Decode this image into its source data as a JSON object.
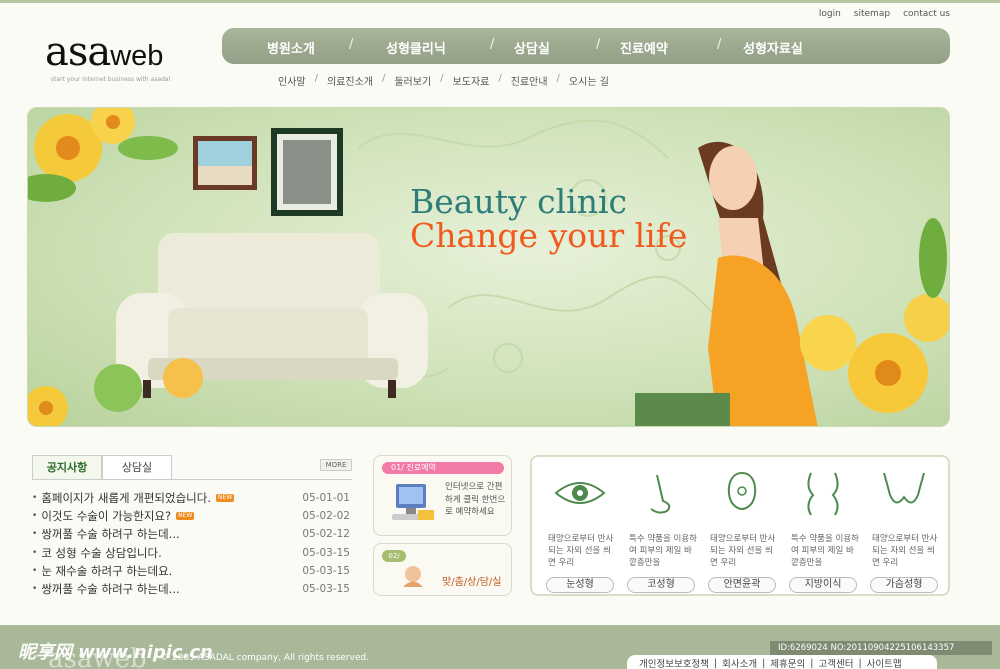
{
  "util_links": [
    "login",
    "sitemap",
    "contact us"
  ],
  "logo": {
    "main": "asa",
    "suffix": "web",
    "tagline": "start your internet business with asadal"
  },
  "gnb": {
    "items": [
      "병원소개",
      "성형클리닉",
      "상담실",
      "진료예약",
      "성형자료실"
    ],
    "separator": "/"
  },
  "subnav": {
    "items": [
      "인사말",
      "의료진소개",
      "둘러보기",
      "보도자료",
      "진료안내",
      "오시는 길"
    ],
    "separator": "/"
  },
  "hero": {
    "title": "Beauty clinic",
    "subtitle": "Change your life"
  },
  "board": {
    "tabs": [
      "공지사항",
      "상담실"
    ],
    "more": "MORE",
    "new_badge": "NEW",
    "items": [
      {
        "title": "홈페이지가 새롭게 개편되었습니다.",
        "date": "05-01-01",
        "is_new": true
      },
      {
        "title": "이것도 수술이 가능한지요?",
        "date": "05-02-02",
        "is_new": true
      },
      {
        "title": "쌍꺼풀 수술 하려구 하는데...",
        "date": "05-02-12",
        "is_new": false
      },
      {
        "title": "코 성형 수술 상담입니다.",
        "date": "05-03-15",
        "is_new": false
      },
      {
        "title": "눈 재수술 하려구 하는데요.",
        "date": "05-03-15",
        "is_new": false
      },
      {
        "title": "쌍꺼풀 수술 하려구 하는데...",
        "date": "05-03-15",
        "is_new": false
      }
    ]
  },
  "reservation": {
    "label": "01/ 진료예약",
    "desc": "인터넷으로 간편하게 클릭 한번으로 예약하세요"
  },
  "consult": {
    "label": "02/",
    "text": "맞/춤/상/담/실"
  },
  "clinics": [
    {
      "icon": "eye-icon",
      "text": "태양으로부터 반사되는 자외 선을 씌면 우리",
      "button": "눈성형"
    },
    {
      "icon": "nose-icon",
      "text": "특수 약품을 이용하여 피부의 제일 바깥층만을",
      "button": "코성형"
    },
    {
      "icon": "face-icon",
      "text": "태양으로부터 반사되는 자외 선을 씌면 우리",
      "button": "안면윤곽"
    },
    {
      "icon": "body-icon",
      "text": "특수 약품을 이용하여 피부의 제일 바깥층만을",
      "button": "지방이식"
    },
    {
      "icon": "chest-icon",
      "text": "태양으로부터 반사되는 자외 선을 씌면 우리",
      "button": "가슴성형"
    }
  ],
  "footer": {
    "logo": "asaweb",
    "copyright": "© 2005 ASADAL company, All rights reserved.",
    "links": [
      "개인정보보호정책",
      "회사소개",
      "제휴문의",
      "고객센터",
      "사이트맵"
    ],
    "link_separator": "|"
  },
  "watermark": "昵享网 www.nipic.cn",
  "image_id": "ID:6269024 NO:20110904225106143357",
  "colors": {
    "nav": "#a1ad93",
    "accent_teal": "#2d7d78",
    "accent_orange": "#f05a1e",
    "pink": "#f27aa6",
    "green_pill": "#a5bd6d"
  }
}
